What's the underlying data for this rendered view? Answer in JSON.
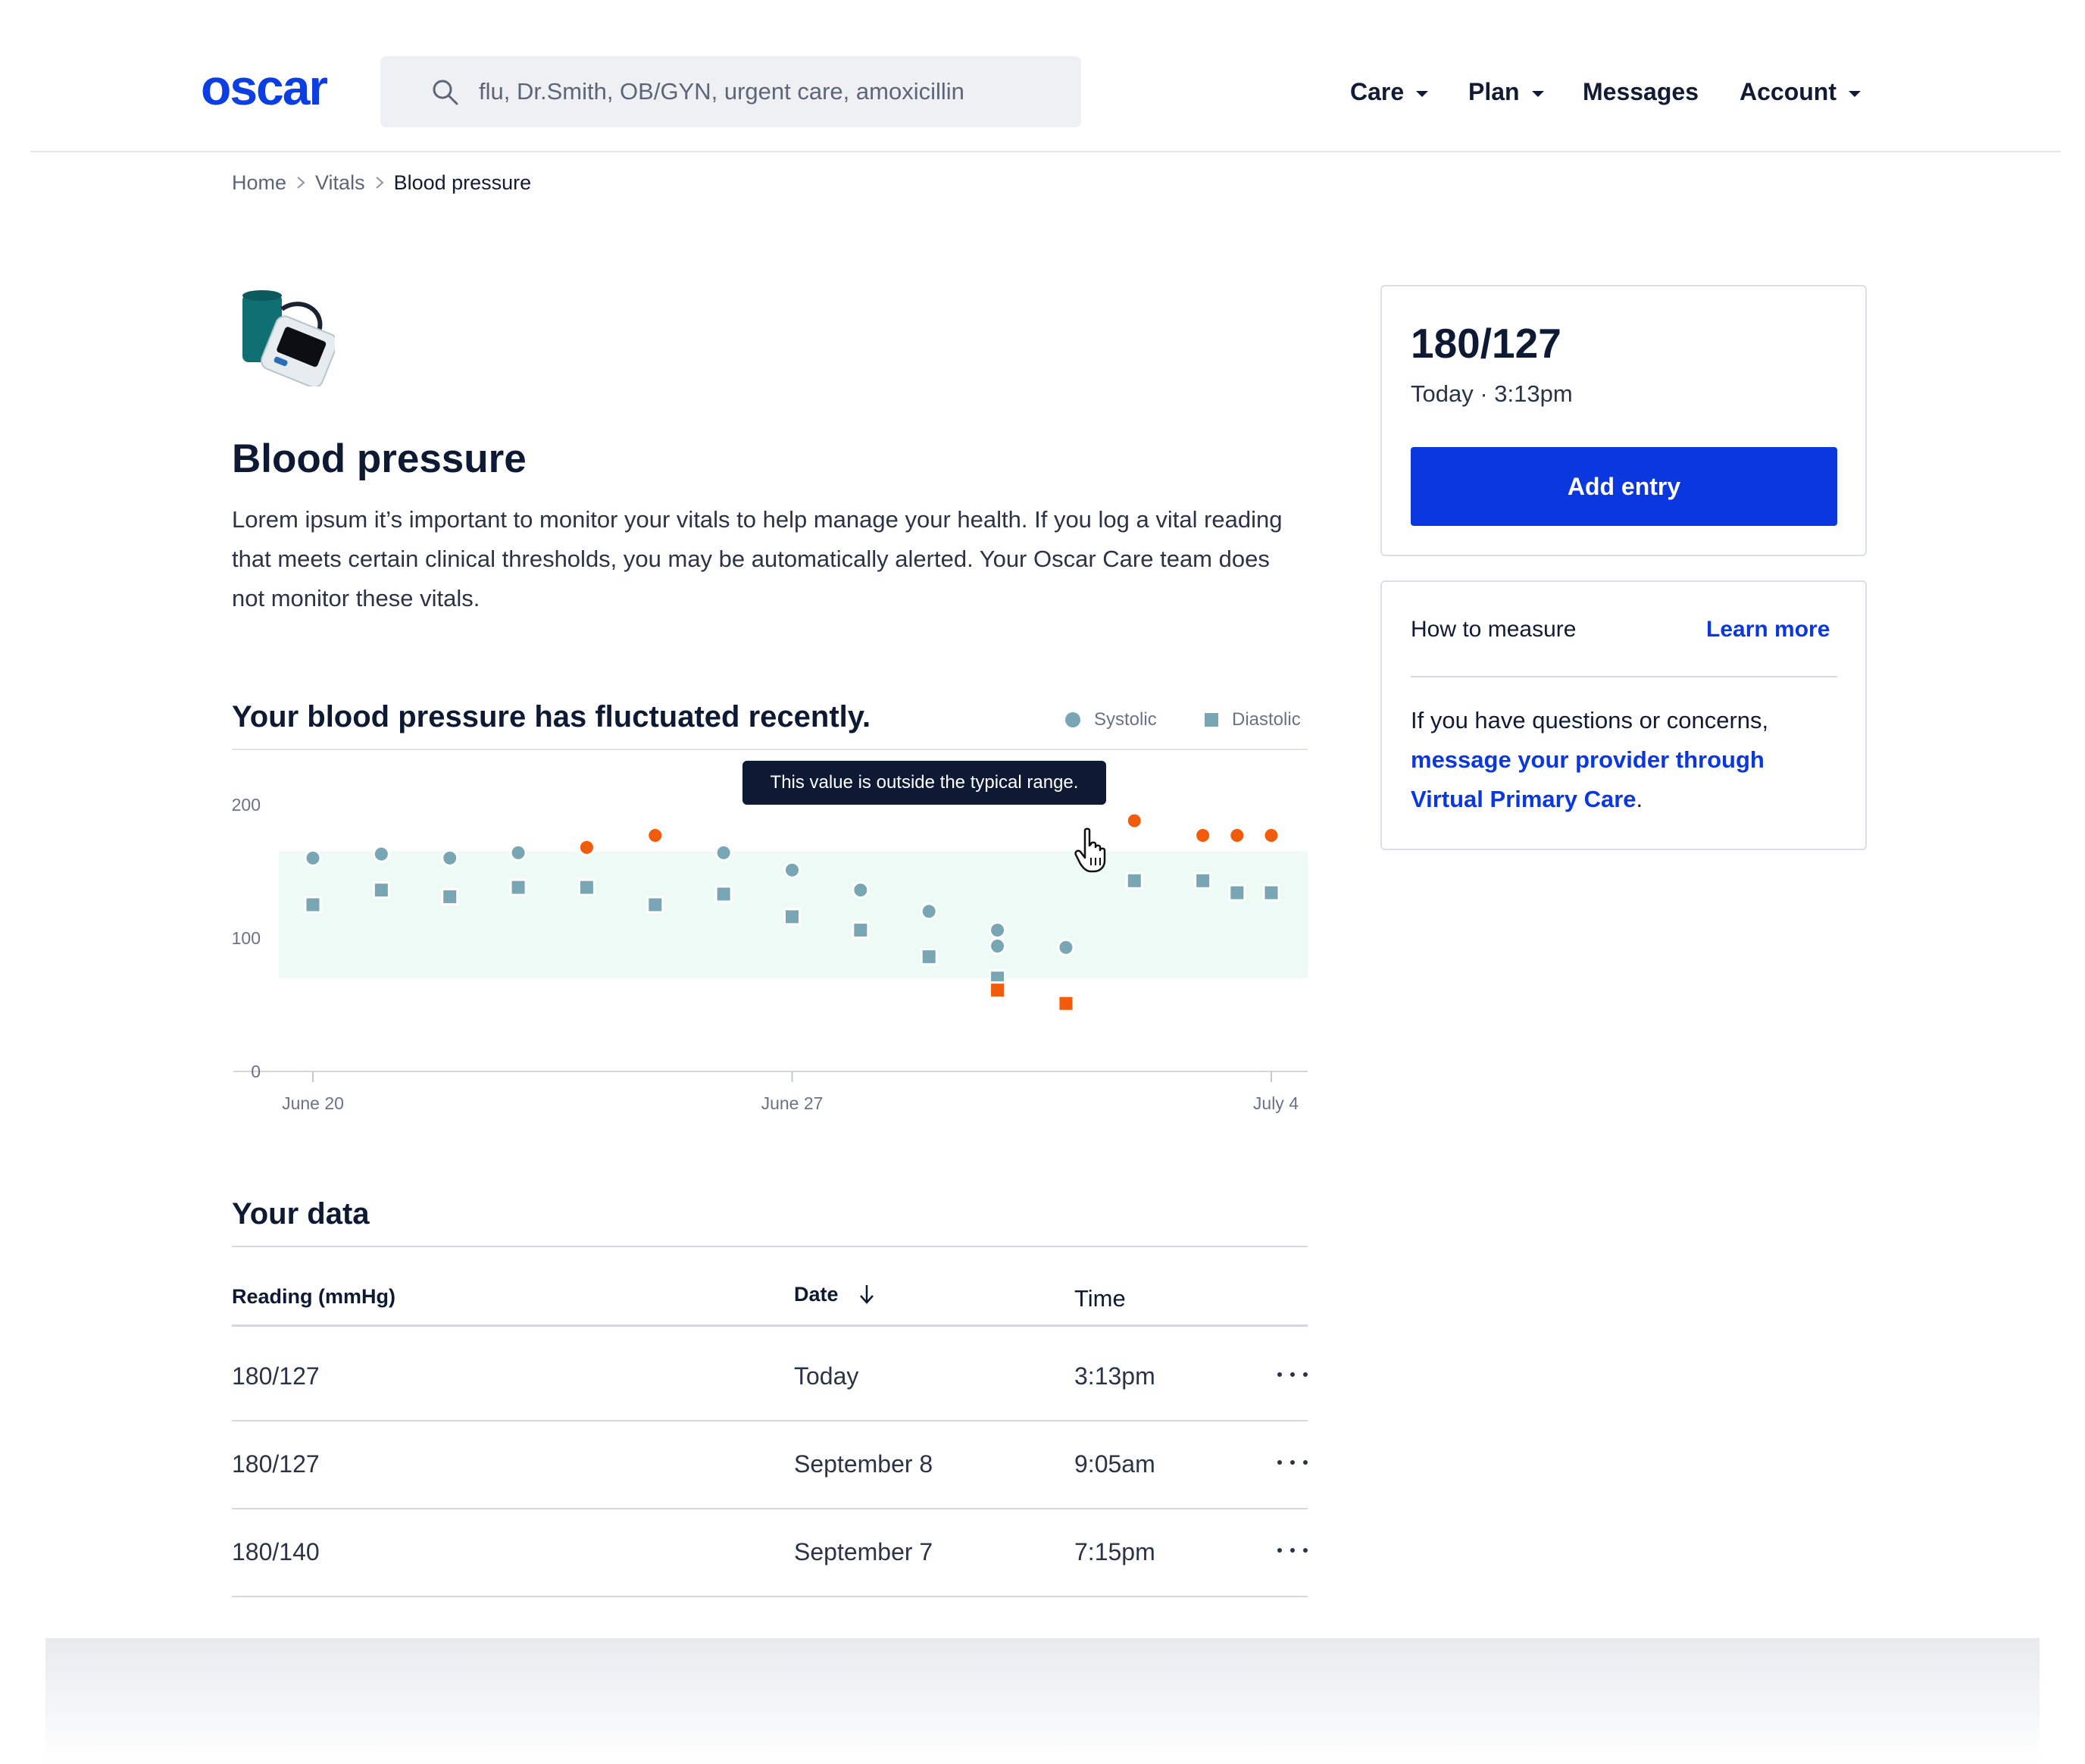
{
  "header": {
    "logo": "oscar",
    "search": {
      "placeholder": "flu, Dr.Smith, OB/GYN, urgent care, amoxicillin"
    },
    "nav": [
      {
        "label": "Care",
        "has_dropdown": true
      },
      {
        "label": "Plan",
        "has_dropdown": true
      },
      {
        "label": "Messages",
        "has_dropdown": false
      },
      {
        "label": "Account",
        "has_dropdown": true
      }
    ]
  },
  "breadcrumb": [
    "Home",
    "Vitals",
    "Blood pressure"
  ],
  "page": {
    "icon": "blood-pressure-monitor-icon",
    "title": "Blood pressure",
    "description": "Lorem ipsum it’s important to monitor your vitals to help manage your health. If you log a vital reading that meets certain clinical thresholds, you may be automatically alerted. Your Oscar Care team does not monitor these vitals."
  },
  "chart_section": {
    "title": "Your blood pressure has fluctuated recently.",
    "tooltip": "This value is outside the typical range."
  },
  "chart_data": {
    "type": "scatter",
    "title": "Your blood pressure has fluctuated recently.",
    "xlabel": "",
    "ylabel": "",
    "x_ticks": [
      "June 20",
      "June 27",
      "July 4"
    ],
    "y_ticks": [
      0,
      100,
      200
    ],
    "ylim": [
      0,
      200
    ],
    "typical_range": [
      70,
      165
    ],
    "legend": {
      "placement": "top-right",
      "entries": [
        "Systolic",
        "Diastolic"
      ]
    },
    "grid": false,
    "colors": {
      "normal": "#79a6b5",
      "out_of_range": "#f25a0c",
      "range_band": "#eefaf6"
    },
    "series": [
      {
        "name": "Systolic",
        "marker": "circle",
        "points": [
          {
            "x": "June 20",
            "y": 160
          },
          {
            "x": "June 21",
            "y": 163
          },
          {
            "x": "June 22",
            "y": 160
          },
          {
            "x": "June 23",
            "y": 164
          },
          {
            "x": "June 24",
            "y": 168
          },
          {
            "x": "June 25",
            "y": 177
          },
          {
            "x": "June 26",
            "y": 164
          },
          {
            "x": "June 27",
            "y": 151
          },
          {
            "x": "June 28",
            "y": 136
          },
          {
            "x": "June 29",
            "y": 120
          },
          {
            "x": "June 30",
            "y": 106
          },
          {
            "x": "June 30",
            "y": 94
          },
          {
            "x": "July 1",
            "y": 93
          },
          {
            "x": "July 2",
            "y": 188
          },
          {
            "x": "July 3",
            "y": 177
          },
          {
            "x": "July 4",
            "y": 177
          },
          {
            "x": "July 4",
            "y": 177
          }
        ]
      },
      {
        "name": "Diastolic",
        "marker": "square",
        "points": [
          {
            "x": "June 20",
            "y": 125
          },
          {
            "x": "June 21",
            "y": 136
          },
          {
            "x": "June 22",
            "y": 131
          },
          {
            "x": "June 23",
            "y": 138
          },
          {
            "x": "June 24",
            "y": 138
          },
          {
            "x": "June 25",
            "y": 125
          },
          {
            "x": "June 26",
            "y": 133
          },
          {
            "x": "June 27",
            "y": 116
          },
          {
            "x": "June 28",
            "y": 106
          },
          {
            "x": "June 29",
            "y": 86
          },
          {
            "x": "June 30",
            "y": 70
          },
          {
            "x": "June 30",
            "y": 61
          },
          {
            "x": "July 1",
            "y": 51
          },
          {
            "x": "July 2",
            "y": 143
          },
          {
            "x": "July 3",
            "y": 143
          },
          {
            "x": "July 4",
            "y": 134
          },
          {
            "x": "July 4",
            "y": 134
          }
        ]
      }
    ]
  },
  "table": {
    "title": "Your data",
    "columns": {
      "reading": "Reading (mmHg)",
      "date": "Date",
      "time": "Time"
    },
    "sort": {
      "column": "Date",
      "direction": "descending"
    },
    "rows": [
      {
        "reading": "180/127",
        "date": "Today",
        "time": "3:13pm"
      },
      {
        "reading": "180/127",
        "date": "September 8",
        "time": "9:05am"
      },
      {
        "reading": "180/140",
        "date": "September 7",
        "time": "7:15pm"
      }
    ]
  },
  "latest_card": {
    "reading": "180/127",
    "time": "Today · 3:13pm",
    "button": "Add entry"
  },
  "info_card": {
    "title": "How to measure",
    "link": "Learn more",
    "help_text": "If you have questions or concerns,",
    "help_link": "message your provider through Virtual Primary Care",
    "help_end": "."
  },
  "colors": {
    "brand": "#0b3ee3",
    "button": "#0a38de",
    "text": "#0e1a33",
    "muted": "#5d6677"
  }
}
